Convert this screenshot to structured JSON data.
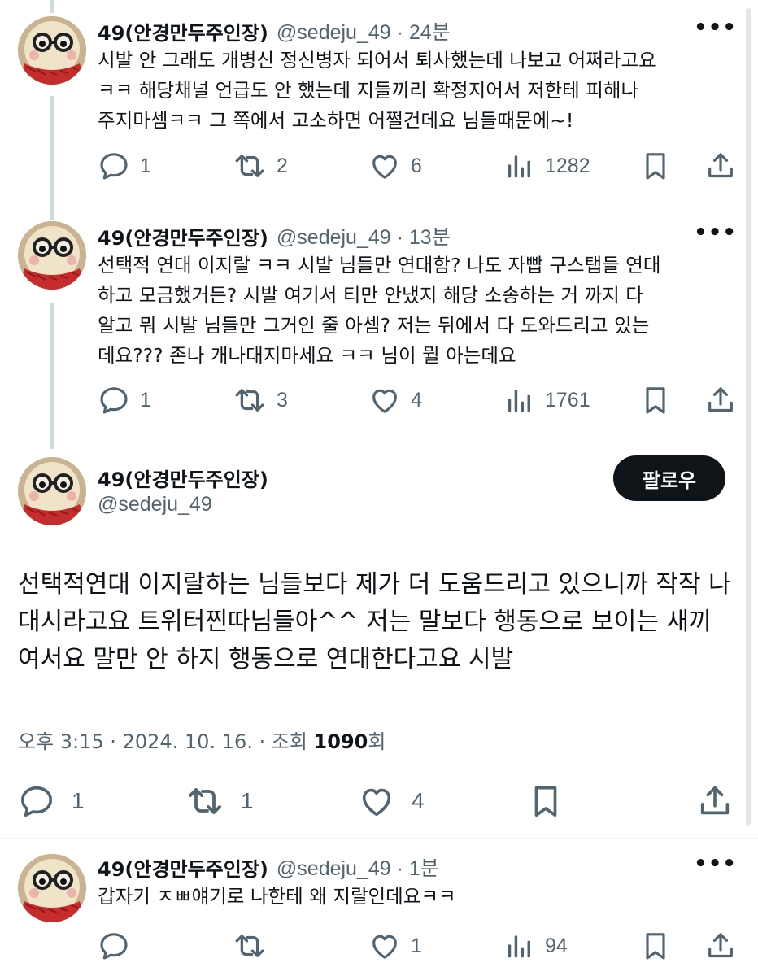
{
  "posts": [
    {
      "name": "49(안경만두주인장)",
      "handle_time": "@sedeju_49 · 24분",
      "text": "시발 안 그래도 개병신 정신병자 되어서 퇴사했는데 나보고 어쩌라고요\nㅋㅋ 해당채널 언급도 안 했는데 지들끼리 확정지어서 저한테 피해나\n주지마셈ㅋㅋ 그 쪽에서 고소하면 어쩔건데요 님들때문에~!",
      "replies": "1",
      "reposts": "2",
      "likes": "6",
      "views": "1282"
    },
    {
      "name": "49(안경만두주인장)",
      "handle_time": "@sedeju_49 · 13분",
      "text": "선택적 연대 이지랄 ㅋㅋ 시발 님들만 연대함? 나도 자빱 구스탭들 연대\n하고 모금했거든? 시발 여기서 티만 안냈지 해당 소송하는 거 까지 다\n알고 뭐 시발 님들만 그거인 줄 아셈? 저는 뒤에서 다 도와드리고 있는\n데요??? 존나 개나대지마세요 ㅋㅋ 님이 뭘 아는데요",
      "replies": "1",
      "reposts": "3",
      "likes": "4",
      "views": "1761"
    }
  ],
  "main_post": {
    "name": "49(안경만두주인장)",
    "handle": "@sedeju_49",
    "follow_label": "팔로우",
    "text": "선택적연대 이지랄하는 님들보다 제가 더 도움드리고 있으니까 작작 나대시라고요 트위터찐따님들아^^ 저는 말보다 행동으로 보이는 새끼여서요 말만 안 하지 행동으로 연대한다고요 시발",
    "timestamp_prefix": "오후 3:15 · 2024. 10. 16. · 조회 ",
    "view_count": "1090",
    "view_suffix": "회",
    "replies": "1",
    "reposts": "1",
    "likes": "4"
  },
  "reply": {
    "name": "49(안경만두주인장)",
    "handle_time": "@sedeju_49 · 1분",
    "text": "갑자기 ㅈㅃ얘기로 나한테 왜 지랄인데요ㅋㅋ",
    "replies": "",
    "reposts": "",
    "likes": "1",
    "views": "94"
  },
  "more_glyph": "•••",
  "colors": {
    "text": "#0f1419",
    "muted": "#536471",
    "line": "#cfd9de",
    "button": "#0f1419"
  }
}
